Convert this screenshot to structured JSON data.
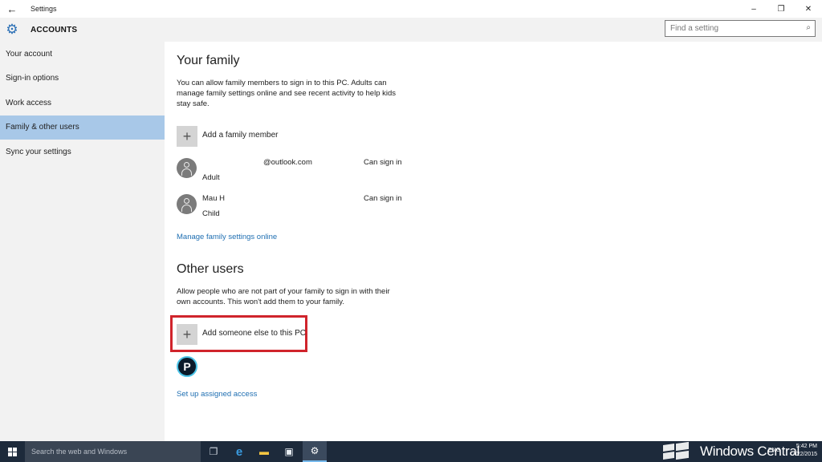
{
  "window": {
    "title": "Settings",
    "back_icon": "←",
    "minimize": "–",
    "maximize": "❐",
    "close": "✕"
  },
  "sidebar": {
    "header": "ACCOUNTS",
    "items": [
      {
        "label": "Your account"
      },
      {
        "label": "Sign-in options"
      },
      {
        "label": "Work access"
      },
      {
        "label": "Family & other users",
        "active": true
      },
      {
        "label": "Sync your settings"
      }
    ]
  },
  "search": {
    "placeholder": "Find a setting"
  },
  "family": {
    "title": "Your family",
    "description": "You can allow family members to sign in to this PC. Adults can manage family settings online and see recent activity to help kids stay safe.",
    "add_label": "Add a family member",
    "members": [
      {
        "name": "@outlook.com",
        "role": "Adult",
        "status": "Can sign in"
      },
      {
        "name": "Mau H",
        "role": "Child",
        "status": "Can sign in"
      }
    ],
    "manage_link": "Manage family settings online"
  },
  "other_users": {
    "title": "Other users",
    "description": "Allow people who are not part of your family to sign in with their own accounts. This won't add them to your family.",
    "add_label": "Add someone else to this PC",
    "user_initial": "P",
    "assigned_access_link": "Set up assigned access"
  },
  "taskbar": {
    "search_placeholder": "Search the web and Windows",
    "watermark": "Windows Central",
    "lang": "ENG",
    "time": "5:42 PM",
    "date": "7/22/2015"
  },
  "colors": {
    "accent": "#2a6fb5",
    "active_nav": "#a8c8e8",
    "link": "#1f6fb2",
    "highlight": "#d0242c",
    "taskbar": "#1d2a3b"
  }
}
